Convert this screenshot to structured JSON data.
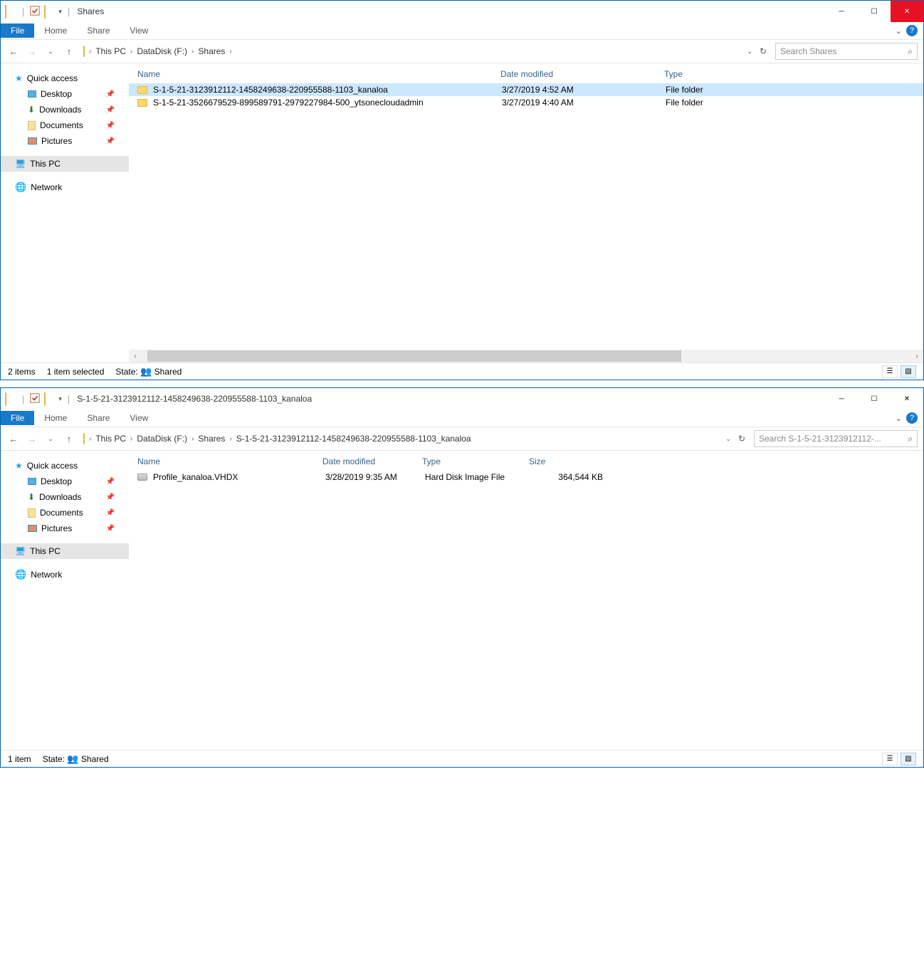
{
  "window1": {
    "title": "Shares",
    "tabs": {
      "file": "File",
      "home": "Home",
      "share": "Share",
      "view": "View"
    },
    "breadcrumb": [
      "This PC",
      "DataDisk (F:)",
      "Shares"
    ],
    "search_placeholder": "Search Shares",
    "nav": {
      "quick_access": "Quick access",
      "desktop": "Desktop",
      "downloads": "Downloads",
      "documents": "Documents",
      "pictures": "Pictures",
      "this_pc": "This PC",
      "network": "Network"
    },
    "columns": {
      "name": "Name",
      "date": "Date modified",
      "type": "Type"
    },
    "rows": [
      {
        "name": "S-1-5-21-3123912112-1458249638-220955588-1103_kanaloa",
        "date": "3/27/2019 4:52 AM",
        "type": "File folder",
        "selected": true
      },
      {
        "name": "S-1-5-21-3526679529-899589791-2979227984-500_ytsonecloudadmin",
        "date": "3/27/2019 4:40 AM",
        "type": "File folder",
        "selected": false
      }
    ],
    "status": {
      "items": "2 items",
      "selected": "1 item selected",
      "state_label": "State:",
      "state_value": "Shared"
    }
  },
  "window2": {
    "title": "S-1-5-21-3123912112-1458249638-220955588-1103_kanaloa",
    "tabs": {
      "file": "File",
      "home": "Home",
      "share": "Share",
      "view": "View"
    },
    "breadcrumb": [
      "This PC",
      "DataDisk (F:)",
      "Shares",
      "S-1-5-21-3123912112-1458249638-220955588-1103_kanaloa"
    ],
    "search_placeholder": "Search S-1-5-21-3123912112-...",
    "nav": {
      "quick_access": "Quick access",
      "desktop": "Desktop",
      "downloads": "Downloads",
      "documents": "Documents",
      "pictures": "Pictures",
      "this_pc": "This PC",
      "network": "Network"
    },
    "columns": {
      "name": "Name",
      "date": "Date modified",
      "type": "Type",
      "size": "Size"
    },
    "rows": [
      {
        "name": "Profile_kanaloa.VHDX",
        "date": "3/28/2019 9:35 AM",
        "type": "Hard Disk Image File",
        "size": "364,544 KB"
      }
    ],
    "status": {
      "items": "1 item",
      "state_label": "State:",
      "state_value": "Shared"
    }
  }
}
